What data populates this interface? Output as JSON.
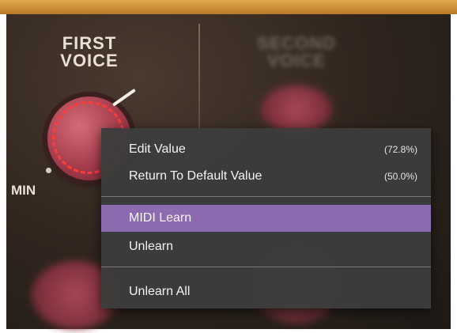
{
  "voice_panel": {
    "first_voice_title": "FIRST\nVOICE",
    "second_voice_title": "SECOND\nVOICE",
    "min_label": "MIN"
  },
  "context_menu": {
    "items": [
      {
        "label": "Edit Value",
        "value": "(72.8%)"
      },
      {
        "label": "Return To Default Value",
        "value": "(50.0%)"
      },
      {
        "label": "MIDI Learn",
        "highlighted": true
      },
      {
        "label": "Unlearn"
      },
      {
        "label": "Unlearn All"
      }
    ]
  },
  "colors": {
    "menu_background": "#3c3c3c",
    "highlight": "#8c6bb0",
    "knob": "#b54b5b",
    "knob_ring": "#ff3b3b"
  }
}
